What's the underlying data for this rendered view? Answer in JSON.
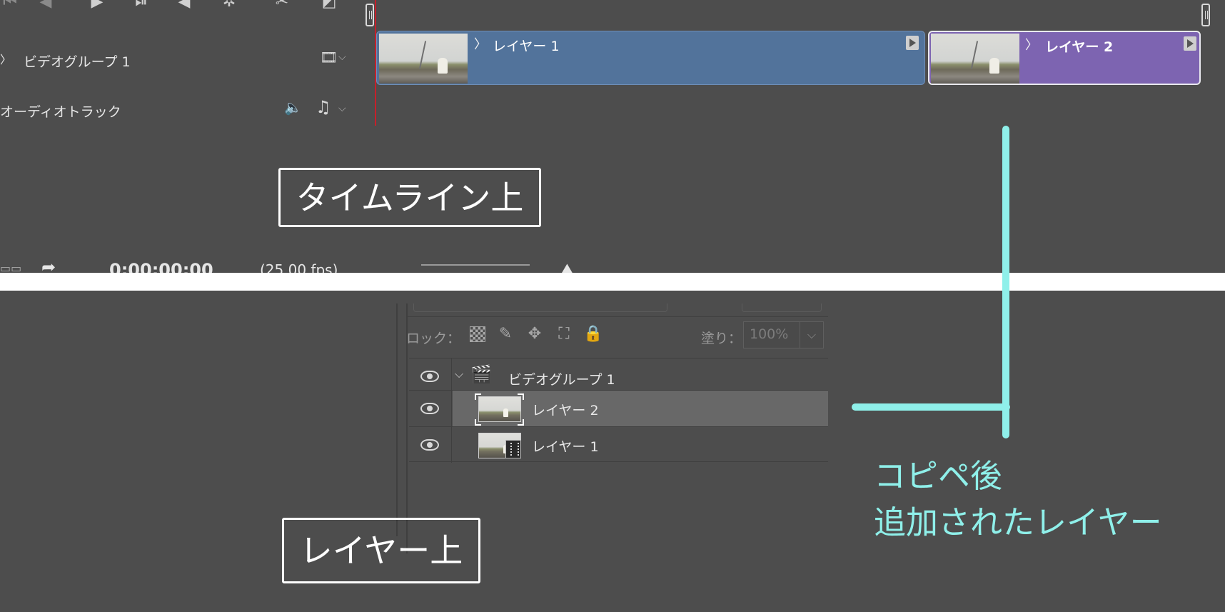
{
  "timeline": {
    "toolbar": {
      "icons": [
        "go-to-first-frame-icon",
        "step-back-icon",
        "play-icon",
        "step-forward-icon",
        "mute-icon",
        "settings-icon",
        "split-icon",
        "transition-icon"
      ],
      "glyphs": {
        "play": "▶",
        "step_forward": "⏯",
        "audio": "◀",
        "settings": "✲",
        "split": "✂",
        "transition": "◩"
      }
    },
    "tracks": [
      {
        "chevron": "〉",
        "label": "ビデオグループ 1",
        "icon": "film-strip-icon",
        "icon_glyph": "🎞",
        "dropdown": "⌵"
      },
      {
        "label": "オーディオトラック",
        "icons": [
          "speaker-icon",
          "music-note-icon"
        ],
        "speaker_glyph": "🔈",
        "note_glyph": "♫",
        "dropdown": "⌵"
      }
    ],
    "clips": [
      {
        "chevron": "〉",
        "name": "レイヤー 1",
        "color": "#52739b"
      },
      {
        "chevron": "〉",
        "name": "レイヤー 2",
        "color": "#7d64b1"
      }
    ],
    "caption": "タイムライン上",
    "status": {
      "timecode": "0:00:00:00",
      "fps": "(25.00 fps)"
    }
  },
  "layers_panel": {
    "lock_label": "ロック：",
    "lock_icons": [
      "lock-transparent-pixels-icon",
      "lock-image-pixels-icon",
      "lock-position-icon",
      "lock-artboard-icon",
      "lock-all-icon"
    ],
    "lock_glyphs": {
      "brush": "✎",
      "move": "✥",
      "artboard": "⛶",
      "lock": "🔒"
    },
    "fill_label": "塗り：",
    "fill_value": "100%",
    "fill_dropdown": "⌵",
    "group": {
      "name": "ビデオグループ 1",
      "expand_glyph": "⌵",
      "icon_glyph": "🎬"
    },
    "layers": [
      {
        "name": "レイヤー 2",
        "selected": true
      },
      {
        "name": "レイヤー 1",
        "selected": false
      }
    ],
    "caption": "レイヤー上"
  },
  "annotation": {
    "line1": "コピペ後",
    "line2": "追加されたレイヤー",
    "color": "#8ff0ea"
  }
}
